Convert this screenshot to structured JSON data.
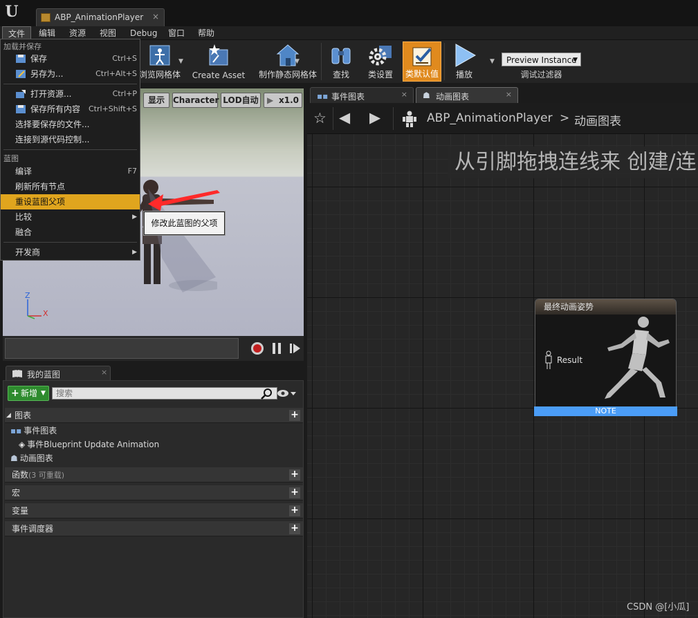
{
  "window": {
    "tab_title": "ABP_AnimationPlayer",
    "tab_close": "×"
  },
  "menubar": [
    "文件",
    "编辑",
    "资源",
    "视图",
    "Debug",
    "窗口",
    "帮助"
  ],
  "toolbar": {
    "preview_mesh": "浏览网格体",
    "create_asset": "Create Asset",
    "make_static_mesh": "制作静态网格体",
    "find": "查找",
    "class_settings": "类设置",
    "class_defaults": "类默认值",
    "play": "播放",
    "preview_instance": "Preview Instance",
    "debug_filter": "调试过滤器"
  },
  "viewport": {
    "show_label": "显示",
    "character_label": "Character",
    "lod_label": "LOD自动",
    "speed_label": "x1.0",
    "axis_x": "X",
    "axis_z": "Z"
  },
  "file_menu": {
    "section_load_save": "加载并保存",
    "save": "保存",
    "save_shortcut": "Ctrl+S",
    "save_as": "另存为...",
    "save_as_shortcut": "Ctrl+Alt+S",
    "open_asset": "打开资源...",
    "open_asset_shortcut": "Ctrl+P",
    "save_all": "保存所有内容",
    "save_all_shortcut": "Ctrl+Shift+S",
    "choose_files": "选择要保存的文件...",
    "connect_source_control": "连接到源代码控制...",
    "section_blueprint": "蓝图",
    "compile": "编译",
    "compile_shortcut": "F7",
    "refresh_nodes": "刷新所有节点",
    "reparent": "重设蓝图父项",
    "diff": "比较",
    "merge": "融合",
    "developer": "开发商",
    "tooltip": "修改此蓝图的父项"
  },
  "my_blueprint": {
    "tab_label": "我的蓝图",
    "tab_close": "×",
    "add_new": "新增",
    "search_placeholder": "搜索",
    "sections": {
      "graphs": "图表",
      "functions": "函数",
      "functions_note": "(3 可重载)",
      "macros": "宏",
      "variables": "变量",
      "event_dispatchers": "事件调度器"
    },
    "tree": {
      "event_graph": "事件图表",
      "event_item": "事件Blueprint Update Animation",
      "anim_graph": "动画图表"
    }
  },
  "graph": {
    "tabs": [
      {
        "label": "事件图表",
        "close": "×"
      },
      {
        "label": "动画图表",
        "close": "×"
      }
    ],
    "breadcrumb_root": "ABP_AnimationPlayer",
    "breadcrumb_sep": ">",
    "breadcrumb_current": "动画图表",
    "hint": "从引脚拖拽连线来 创建/连",
    "result_node": {
      "title": "最终动画姿势",
      "pin": "Result",
      "note": "NOTE"
    }
  },
  "watermark": "CSDN @[小瓜]",
  "colors": {
    "accent_orange": "#e08a1e",
    "menu_highlight": "#e0a51e",
    "note_blue": "#4b9df7",
    "add_green": "#2e8b2e"
  }
}
